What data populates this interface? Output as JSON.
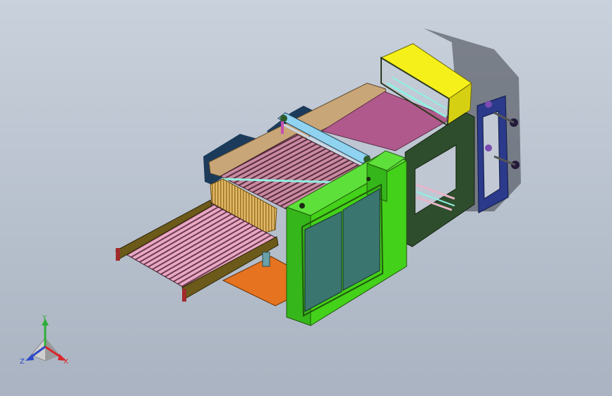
{
  "viewport": {
    "background_top": "#c9d1dc",
    "background_bottom": "#aab3c1"
  },
  "model": {
    "colors": {
      "side_frame": "#44d11a",
      "side_frame_dark": "#2f9c12",
      "door_panel": "#3b7570",
      "rear_frame": "#2e4d2c",
      "top_box": "#f6f01a",
      "pink_deck": "#b0598c",
      "conveyor_belt": "#e9a8c4",
      "conveyor_frame": "#6b5a1a",
      "blue_panel": "#2b3a8a",
      "cyan_rail": "#8ff0e2",
      "orange_base": "#e5731f",
      "navy_housing": "#1c3b5a"
    }
  },
  "triad": {
    "x_label": "X",
    "y_label": "Y",
    "z_label": "Z",
    "x_color": "#d8262c",
    "y_color": "#2fae3a",
    "z_color": "#2f49c9"
  }
}
